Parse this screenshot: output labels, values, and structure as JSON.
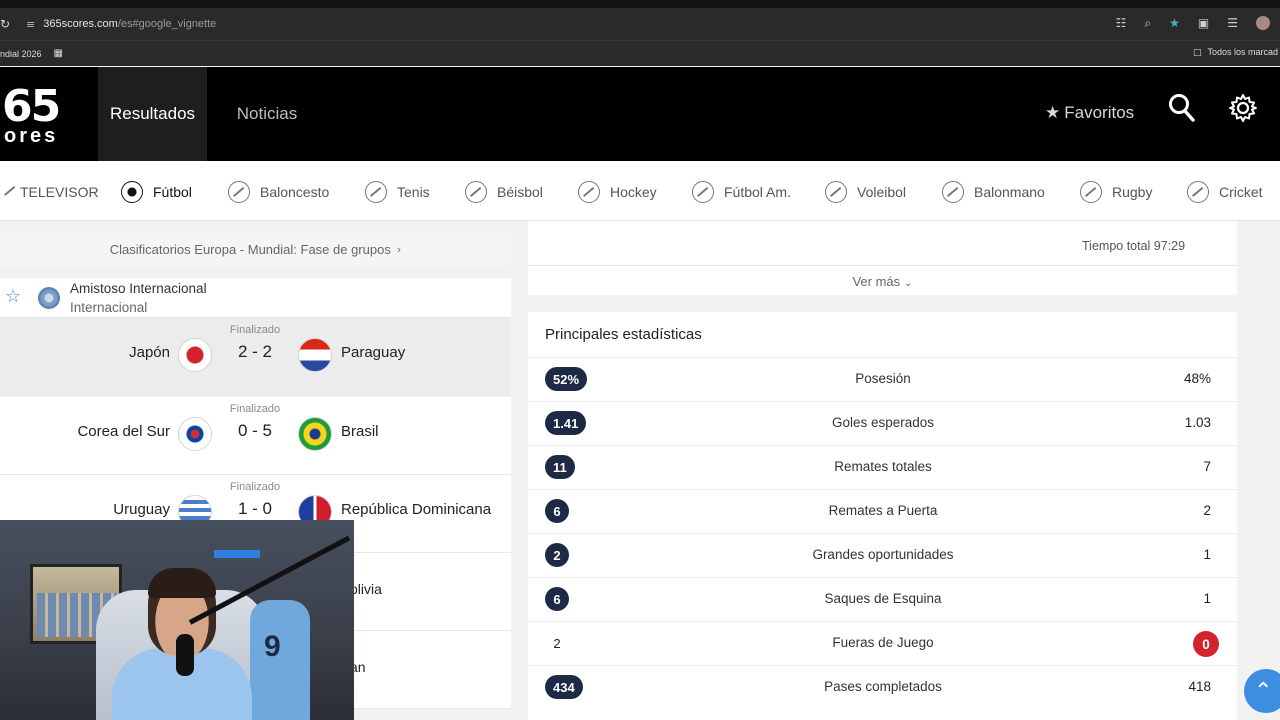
{
  "browser": {
    "url_domain": "365scores.com",
    "url_path": "/es#google_vignette",
    "bookmark_left": "ndial 2026",
    "bookmark_right": "Todos los marcad"
  },
  "header": {
    "logo_top": "65",
    "logo_bottom": "ores",
    "tabs": [
      {
        "label": "Resultados",
        "active": true
      },
      {
        "label": "Noticias",
        "active": false
      }
    ],
    "favorites_label": "Favoritos"
  },
  "sports": [
    {
      "label": "TELEVISOR",
      "icon": "tv-icon"
    },
    {
      "label": "Fútbol",
      "icon": "soccer-ball-icon",
      "active": true
    },
    {
      "label": "Baloncesto",
      "icon": "basketball-icon"
    },
    {
      "label": "Tenis",
      "icon": "tennis-icon"
    },
    {
      "label": "Béisbol",
      "icon": "baseball-icon"
    },
    {
      "label": "Hockey",
      "icon": "hockey-icon"
    },
    {
      "label": "Fútbol Am.",
      "icon": "american-football-icon"
    },
    {
      "label": "Voleibol",
      "icon": "volleyball-icon"
    },
    {
      "label": "Balonmano",
      "icon": "handball-icon"
    },
    {
      "label": "Rugby",
      "icon": "rugby-icon"
    },
    {
      "label": "Cricket",
      "icon": "cricket-icon"
    }
  ],
  "left": {
    "competition_link": "Clasificatorios Europa - Mundial: Fase de grupos",
    "league": {
      "name": "Amistoso Internacional",
      "sub": "Internacional"
    },
    "matches": [
      {
        "status": "Finalizado",
        "home": "Japón",
        "score": "2 - 2",
        "away": "Paraguay"
      },
      {
        "status": "Finalizado",
        "home": "Corea del Sur",
        "score": "0 - 5",
        "away": "Brasil"
      },
      {
        "status": "Finalizado",
        "home": "Uruguay",
        "score": "1 - 0",
        "away": "República Dominicana"
      }
    ],
    "partial_1": "olivia",
    "partial_2": "an"
  },
  "right": {
    "total_time": "Tiempo total 97:29",
    "see_more": "Ver más",
    "stats_title": "Principales estadísticas",
    "stats": [
      {
        "left": "52%",
        "name": "Posesión",
        "right": "48%"
      },
      {
        "left": "1.41",
        "name": "Goles esperados",
        "right": "1.03"
      },
      {
        "left": "11",
        "name": "Remates totales",
        "right": "7"
      },
      {
        "left": "6",
        "name": "Remates a Puerta",
        "right": "2"
      },
      {
        "left": "2",
        "name": "Grandes oportunidades",
        "right": "1"
      },
      {
        "left": "6",
        "name": "Saques de Esquina",
        "right": "1"
      },
      {
        "left": "2",
        "name": "Fueras de Juego",
        "right": "0"
      },
      {
        "left": "434",
        "name": "Pases completados",
        "right": "418"
      }
    ]
  },
  "webcam": {
    "jersey_number": "9"
  },
  "colors": {
    "header_bg": "#000000",
    "badge_bg": "#1d2a46",
    "badge_red": "#d5232b",
    "accent_blue": "#3d8ee0"
  }
}
